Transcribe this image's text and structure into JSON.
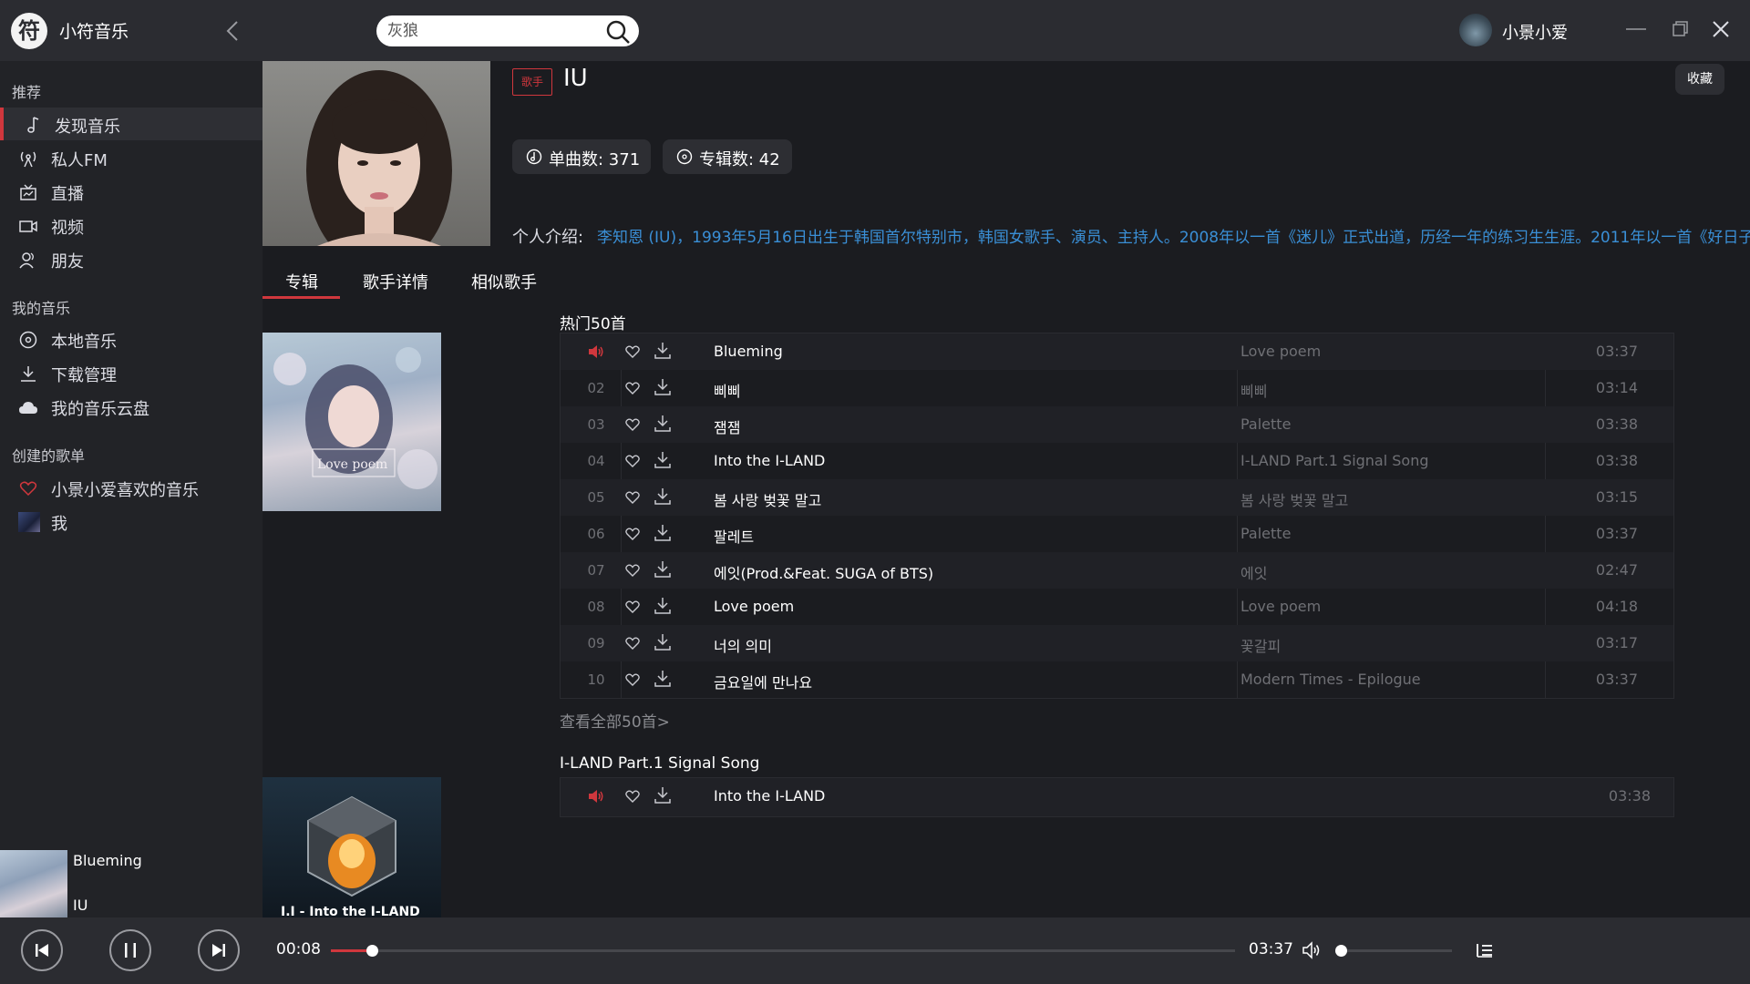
{
  "app": {
    "logo_char": "符",
    "name": "小符音乐"
  },
  "search": {
    "value": "",
    "placeholder": "灰狼"
  },
  "user": {
    "name": "小景小爱"
  },
  "sidebar": {
    "sections": [
      {
        "title": "推荐",
        "items": [
          {
            "label": "发现音乐",
            "icon": "music-note-icon",
            "active": true
          },
          {
            "label": "私人FM",
            "icon": "radio-icon"
          },
          {
            "label": "直播",
            "icon": "live-tv-icon"
          },
          {
            "label": "视频",
            "icon": "video-icon"
          },
          {
            "label": "朋友",
            "icon": "friends-icon"
          }
        ]
      },
      {
        "title": "我的音乐",
        "items": [
          {
            "label": "本地音乐",
            "icon": "disc-icon"
          },
          {
            "label": "下载管理",
            "icon": "download-icon"
          },
          {
            "label": "我的音乐云盘",
            "icon": "cloud-icon"
          }
        ]
      },
      {
        "title": "创建的歌单",
        "items": [
          {
            "label": "小景小爱喜欢的音乐",
            "icon": "heart-icon"
          },
          {
            "label": "我",
            "icon": "playlist-thumbnail"
          }
        ]
      }
    ]
  },
  "artist": {
    "badge": "歌手",
    "name": "IU",
    "favorite_label": "收藏",
    "singles_label": "单曲数: 371",
    "albums_label": "专辑数: 42",
    "intro_label": "个人介绍:",
    "intro_text": "李知恩 (IU)，1993年5月16日出生于韩国首尔特别市，韩国女歌手、演员、主持人。2008年以一首《迷儿》正式出道，历经一年的练习生生涯。2011年以一首《好日子》"
  },
  "tabs": [
    {
      "label": "专辑",
      "active": true
    },
    {
      "label": "歌手详情"
    },
    {
      "label": "相似歌手"
    }
  ],
  "albums": [
    {
      "cover_text": "Love poem",
      "title": "热门50首",
      "songs": [
        {
          "num": "",
          "name": "Blueming",
          "album": "Love poem",
          "duration": "03:37",
          "playing": true
        },
        {
          "num": "02",
          "name": "삐삐",
          "album": "삐삐",
          "duration": "03:14"
        },
        {
          "num": "03",
          "name": "잼잼",
          "album": "Palette",
          "duration": "03:38"
        },
        {
          "num": "04",
          "name": "Into the I-LAND",
          "album": "I-LAND Part.1 Signal Song",
          "duration": "03:38"
        },
        {
          "num": "05",
          "name": "봄 사랑 벚꽃 말고",
          "album": "봄 사랑 벚꽃 말고",
          "duration": "03:15"
        },
        {
          "num": "06",
          "name": "팔레트",
          "album": "Palette",
          "duration": "03:37"
        },
        {
          "num": "07",
          "name": "에잇(Prod.&Feat. SUGA of BTS)",
          "album": "에잇",
          "duration": "02:47"
        },
        {
          "num": "08",
          "name": "Love poem",
          "album": "Love poem",
          "duration": "04:18"
        },
        {
          "num": "09",
          "name": "너의 의미",
          "album": "꽃갈피",
          "duration": "03:17"
        },
        {
          "num": "10",
          "name": "금요일에 만나요",
          "album": "Modern Times - Epilogue",
          "duration": "03:37"
        }
      ],
      "view_all": "查看全部50首>"
    },
    {
      "cover_text": "I.I - Into the I-LAND",
      "title": "I-LAND Part.1 Signal Song",
      "songs": [
        {
          "num": "",
          "name": "Into the I-LAND",
          "album": "",
          "duration": "03:38",
          "playing": true
        }
      ]
    }
  ],
  "player": {
    "title": "Blueming",
    "artist": "IU",
    "current_time": "00:08",
    "total_time": "03:37",
    "progress": 0.045,
    "volume": 0.02
  },
  "colors": {
    "accent": "#d0373d",
    "link": "#3a8fd6",
    "background": "#1b1c20",
    "topbar": "#2b2c31"
  }
}
